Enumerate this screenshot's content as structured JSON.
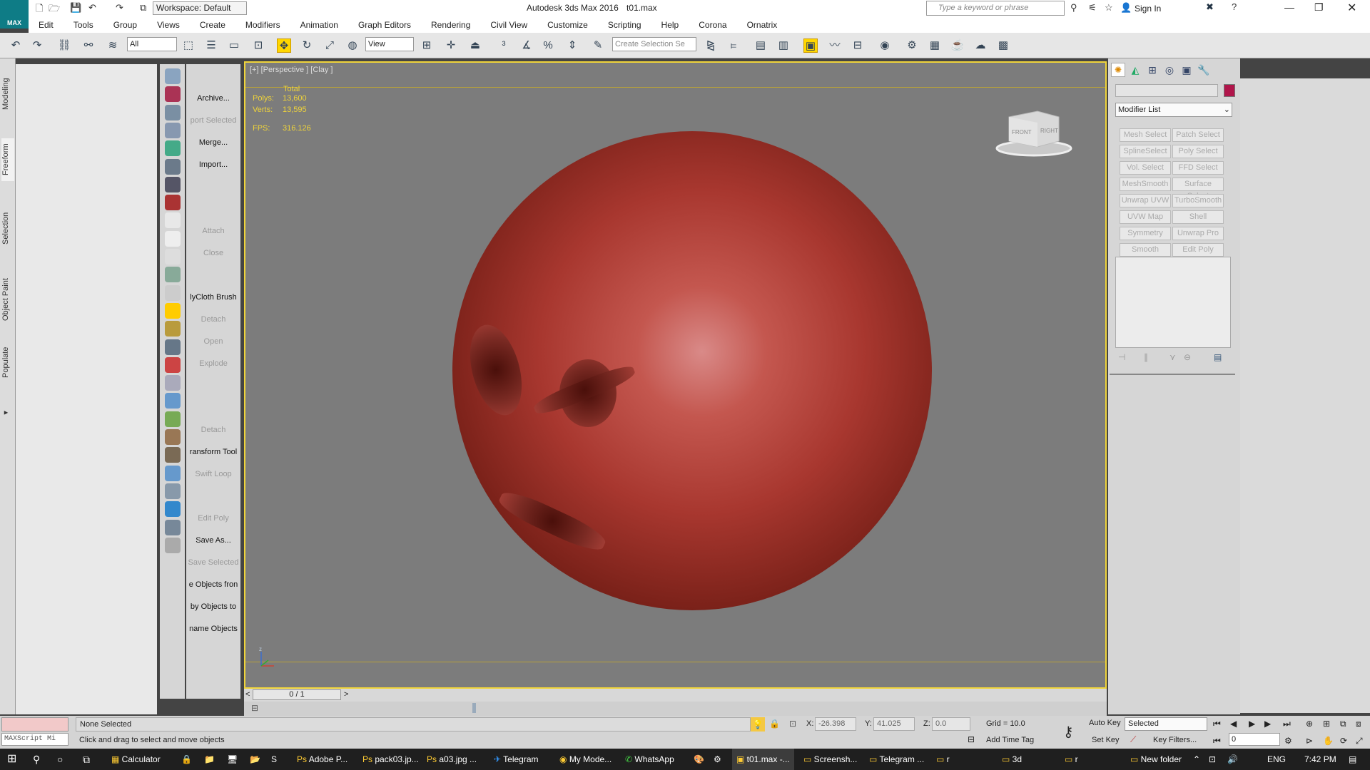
{
  "titlebar": {
    "workspace": "Workspace: Default",
    "title": "Autodesk 3ds Max 2016",
    "file": "t01.max",
    "search_placeholder": "Type a keyword or phrase",
    "sign_in": "Sign In",
    "logo": "MAX"
  },
  "menus": [
    "Edit",
    "Tools",
    "Group",
    "Views",
    "Create",
    "Modifiers",
    "Animation",
    "Graph Editors",
    "Rendering",
    "Civil View",
    "Customize",
    "Scripting",
    "Help",
    "Corona",
    "Ornatrix"
  ],
  "toolbar": {
    "filter": "All",
    "ref_coord": "View",
    "selection_set_placeholder": "Create Selection Se"
  },
  "left_tabs": [
    "Modeling",
    "Freeform",
    "Selection",
    "Object Paint",
    "Populate"
  ],
  "script_panel": [
    {
      "label": "Archive...",
      "dim": false
    },
    {
      "label": "port Selected",
      "dim": true
    },
    {
      "label": "Merge...",
      "dim": false
    },
    {
      "label": "Import...",
      "dim": false
    },
    {
      "label": "",
      "dim": false
    },
    {
      "label": "",
      "dim": false
    },
    {
      "label": "Attach",
      "dim": true
    },
    {
      "label": "Close",
      "dim": true
    },
    {
      "label": "",
      "dim": false
    },
    {
      "label": "lyCloth Brush",
      "dim": false
    },
    {
      "label": "Detach",
      "dim": true
    },
    {
      "label": "Open",
      "dim": true
    },
    {
      "label": "Explode",
      "dim": true
    },
    {
      "label": "",
      "dim": false
    },
    {
      "label": "",
      "dim": false
    },
    {
      "label": "Detach",
      "dim": true
    },
    {
      "label": "ransform Tool",
      "dim": false
    },
    {
      "label": "Swift Loop",
      "dim": true
    },
    {
      "label": "",
      "dim": false
    },
    {
      "label": "Edit Poly",
      "dim": true
    },
    {
      "label": "Save As...",
      "dim": false
    },
    {
      "label": "Save Selected",
      "dim": true
    },
    {
      "label": "e Objects fron",
      "dim": false
    },
    {
      "label": "by Objects to",
      "dim": false
    },
    {
      "label": "name Objects",
      "dim": false
    }
  ],
  "viewport": {
    "label": "[+] [Perspective ] [Clay ]",
    "stats_header": "Total",
    "polys_label": "Polys:",
    "polys": "13,600",
    "verts_label": "Verts:",
    "verts": "13,595",
    "fps_label": "FPS:",
    "fps": "316.126",
    "navcube_front": "FRONT",
    "navcube_right": "RIGHT",
    "axis_z": "z"
  },
  "timeslider": {
    "frame": "0 / 1",
    "prev": "<",
    "next": ">"
  },
  "command_panel": {
    "modifier_list": "Modifier List",
    "color": "#b0154a",
    "buttons": [
      "Mesh Select",
      "Patch Select",
      "SplineSelect",
      "Poly Select",
      "Vol. Select",
      "FFD Select",
      "MeshSmooth",
      "Surface Select",
      "Unwrap UVW",
      "TurboSmooth",
      "UVW Map",
      "Shell",
      "Symmetry",
      "Unwrap Pro",
      "Smooth",
      "Edit Poly"
    ]
  },
  "status": {
    "maxscript": "MAXScript Mi",
    "selection": "None Selected",
    "prompt": "Click and drag to select and move objects",
    "x_label": "X:",
    "x": "-26.398",
    "y_label": "Y:",
    "y": "41.025",
    "z_label": "Z:",
    "z": "0.0",
    "grid": "Grid = 10.0",
    "add_time_tag": "Add Time Tag",
    "auto_key": "Auto Key",
    "set_key": "Set Key",
    "selected": "Selected",
    "key_filters": "Key Filters...",
    "frame_input": "0"
  },
  "taskbar": {
    "items": [
      "Calculator",
      "Adobe P...",
      "pack03.jp...",
      "a03.jpg ...",
      "Telegram",
      "My Mode...",
      "WhatsApp",
      "t01.max -...",
      "Screensh...",
      "Telegram ...",
      "r",
      "3d",
      "r",
      "New folder"
    ],
    "lang": "ENG",
    "time": "7:42 PM"
  }
}
